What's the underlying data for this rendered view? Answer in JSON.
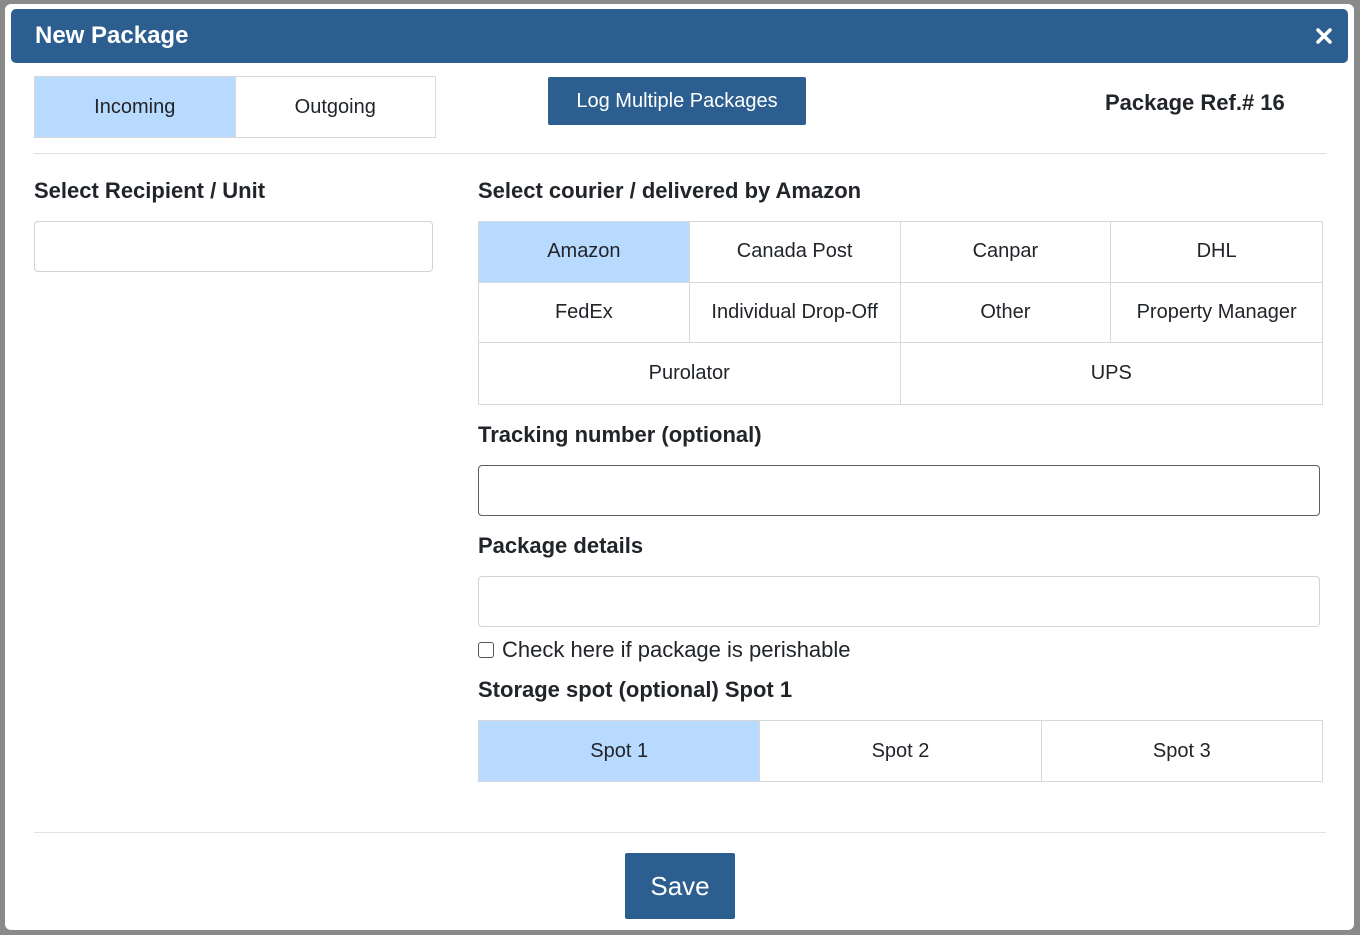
{
  "modal": {
    "title": "New Package"
  },
  "direction": {
    "options": [
      "Incoming",
      "Outgoing"
    ],
    "selected": "Incoming"
  },
  "log_multiple_label": "Log Multiple Packages",
  "package_ref": "Package Ref.# 16",
  "recipient": {
    "label": "Select Recipient / Unit",
    "value": ""
  },
  "courier": {
    "label": "Select courier / delivered by Amazon",
    "options": [
      "Amazon",
      "Canada Post",
      "Canpar",
      "DHL",
      "FedEx",
      "Individual Drop-Off",
      "Other",
      "Property Manager",
      "Purolator",
      "UPS"
    ],
    "selected": "Amazon"
  },
  "tracking": {
    "label": "Tracking number (optional)",
    "value": ""
  },
  "details": {
    "label": "Package details",
    "value": ""
  },
  "perishable": {
    "label": "Check here if package is perishable",
    "checked": false
  },
  "storage": {
    "label": "Storage spot (optional) Spot 1",
    "options": [
      "Spot 1",
      "Spot 2",
      "Spot 3"
    ],
    "selected": "Spot 1"
  },
  "save_label": "Save",
  "colors": {
    "header": "#2c5f8f",
    "active_option": "#b8daff",
    "button": "#2c5f8f"
  }
}
